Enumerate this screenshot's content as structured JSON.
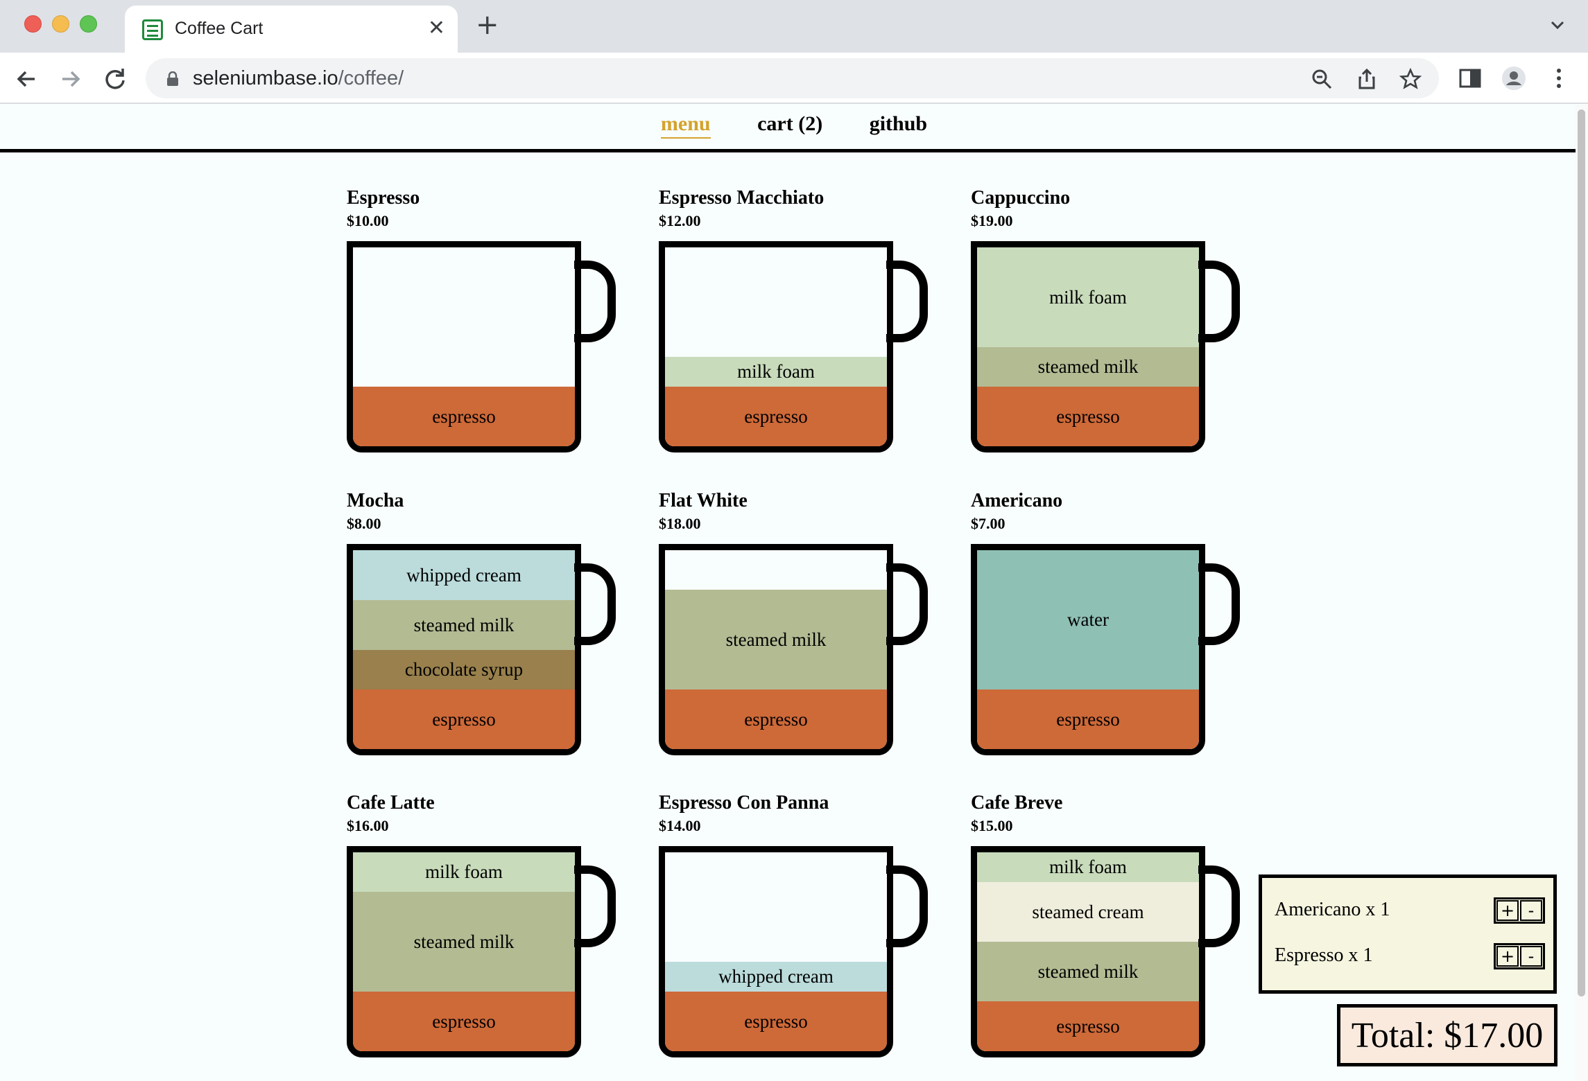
{
  "browser": {
    "tab_title": "Coffee Cart",
    "url_host": "seleniumbase.io",
    "url_path": "/coffee/"
  },
  "nav": {
    "menu": "menu",
    "cart": "cart (2)",
    "github": "github"
  },
  "items": [
    {
      "name": "Espresso",
      "price": "$10.00",
      "layers": [
        {
          "label": "espresso",
          "type": "espresso",
          "pct": 30
        }
      ]
    },
    {
      "name": "Espresso Macchiato",
      "price": "$12.00",
      "layers": [
        {
          "label": "milk foam",
          "type": "milk-foam",
          "pct": 15
        },
        {
          "label": "espresso",
          "type": "espresso",
          "pct": 30
        }
      ]
    },
    {
      "name": "Cappuccino",
      "price": "$19.00",
      "layers": [
        {
          "label": "milk foam",
          "type": "milk-foam",
          "pct": 50
        },
        {
          "label": "steamed milk",
          "type": "steamed-milk",
          "pct": 20
        },
        {
          "label": "espresso",
          "type": "espresso",
          "pct": 30
        }
      ]
    },
    {
      "name": "Mocha",
      "price": "$8.00",
      "layers": [
        {
          "label": "whipped cream",
          "type": "whipped-cream",
          "pct": 25
        },
        {
          "label": "steamed milk",
          "type": "steamed-milk",
          "pct": 25
        },
        {
          "label": "chocolate syrup",
          "type": "chocolate-syrup",
          "pct": 20
        },
        {
          "label": "espresso",
          "type": "espresso",
          "pct": 30
        }
      ]
    },
    {
      "name": "Flat White",
      "price": "$18.00",
      "layers": [
        {
          "label": "steamed milk",
          "type": "steamed-milk",
          "pct": 50
        },
        {
          "label": "espresso",
          "type": "espresso",
          "pct": 30
        }
      ]
    },
    {
      "name": "Americano",
      "price": "$7.00",
      "layers": [
        {
          "label": "water",
          "type": "water",
          "pct": 70
        },
        {
          "label": "espresso",
          "type": "espresso",
          "pct": 30
        }
      ]
    },
    {
      "name": "Cafe Latte",
      "price": "$16.00",
      "layers": [
        {
          "label": "milk foam",
          "type": "milk-foam",
          "pct": 20
        },
        {
          "label": "steamed milk",
          "type": "steamed-milk",
          "pct": 50
        },
        {
          "label": "espresso",
          "type": "espresso",
          "pct": 30
        }
      ]
    },
    {
      "name": "Espresso Con Panna",
      "price": "$14.00",
      "layers": [
        {
          "label": "whipped cream",
          "type": "whipped-cream",
          "pct": 15
        },
        {
          "label": "espresso",
          "type": "espresso",
          "pct": 30
        }
      ]
    },
    {
      "name": "Cafe Breve",
      "price": "$15.00",
      "layers": [
        {
          "label": "milk foam",
          "type": "milk-foam",
          "pct": 15
        },
        {
          "label": "steamed cream",
          "type": "steamed-cream",
          "pct": 30
        },
        {
          "label": "steamed milk",
          "type": "steamed-milk",
          "pct": 30
        },
        {
          "label": "espresso",
          "type": "espresso",
          "pct": 25
        }
      ]
    }
  ],
  "cart_preview": [
    {
      "name": "Americano x 1",
      "plus": "+",
      "minus": "-"
    },
    {
      "name": "Espresso x 1",
      "plus": "+",
      "minus": "-"
    }
  ],
  "total": "Total: $17.00"
}
